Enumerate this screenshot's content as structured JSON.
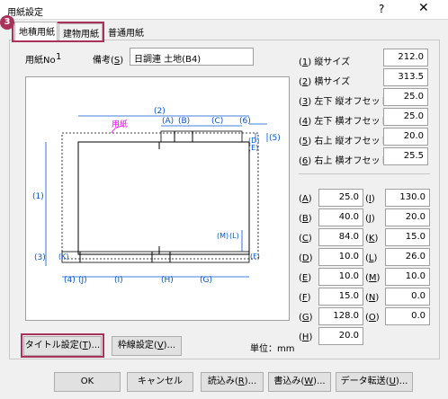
{
  "window": {
    "title": "用紙設定",
    "help_glyph": "?",
    "close_glyph": "✕"
  },
  "badge": "3",
  "tabs": [
    {
      "label": "地積用紙"
    },
    {
      "label": "建物用紙"
    },
    {
      "label": "普通用紙"
    }
  ],
  "paper": {
    "no_label": "用紙No",
    "no_value": "1",
    "note_label_prefix": "備考(",
    "note_key": "S",
    "note_label_suffix": ")",
    "note_value": "日調連 土地(B4)"
  },
  "diagram": {
    "paper_label": "用紙",
    "labels": [
      "(2)",
      "(A)",
      "(B)",
      "(C)",
      "(6)",
      "(D)",
      "(E)",
      "(5)",
      "(1)",
      "(3)",
      "(K)",
      "(M)",
      "(L)",
      "(F)",
      "(4)",
      "(J)",
      "(I)",
      "(H)",
      "(G)"
    ]
  },
  "params": [
    {
      "key": "1",
      "label": "縦サイズ",
      "value": "212.0"
    },
    {
      "key": "2",
      "label": "横サイズ",
      "value": "313.5"
    },
    {
      "key": "3",
      "label": "左下 縦オフセット",
      "value": "25.0"
    },
    {
      "key": "4",
      "label": "左下 横オフセット",
      "value": "25.0"
    },
    {
      "key": "5",
      "label": "右上 縦オフセット",
      "value": "20.0"
    },
    {
      "key": "6",
      "label": "右上 横オフセット",
      "value": "25.5"
    }
  ],
  "letters_left": [
    {
      "key": "A",
      "value": "25.0"
    },
    {
      "key": "B",
      "value": "40.0"
    },
    {
      "key": "C",
      "value": "84.0"
    },
    {
      "key": "D",
      "value": "10.0"
    },
    {
      "key": "E",
      "value": "10.0"
    },
    {
      "key": "F",
      "value": "15.0"
    },
    {
      "key": "G",
      "value": "128.0"
    },
    {
      "key": "H",
      "value": "20.0"
    }
  ],
  "letters_right": [
    {
      "key": "I",
      "value": "130.0"
    },
    {
      "key": "J",
      "value": "20.0"
    },
    {
      "key": "K",
      "value": "15.0"
    },
    {
      "key": "L",
      "value": "26.0"
    },
    {
      "key": "M",
      "value": "10.0"
    },
    {
      "key": "N",
      "value": "0.0"
    },
    {
      "key": "O",
      "value": "0.0"
    }
  ],
  "buttons": {
    "title_setting": {
      "text": "タイトル設定(",
      "key": "T",
      "suffix": ")..."
    },
    "frame_setting": {
      "text": "枠線設定(",
      "key": "V",
      "suffix": ")..."
    },
    "ok": "OK",
    "cancel": "キャンセル",
    "load": {
      "text": "読込み(",
      "key": "R",
      "suffix": ")..."
    },
    "save": {
      "text": "書込み(",
      "key": "W",
      "suffix": ")..."
    },
    "transfer": {
      "text": "データ転送(",
      "key": "U",
      "suffix": ")..."
    }
  },
  "unit_label": "単位：mm",
  "colors": {
    "highlight": "#a8325a",
    "dimension": "#0055cc",
    "paper_label": "#ff00ff"
  }
}
